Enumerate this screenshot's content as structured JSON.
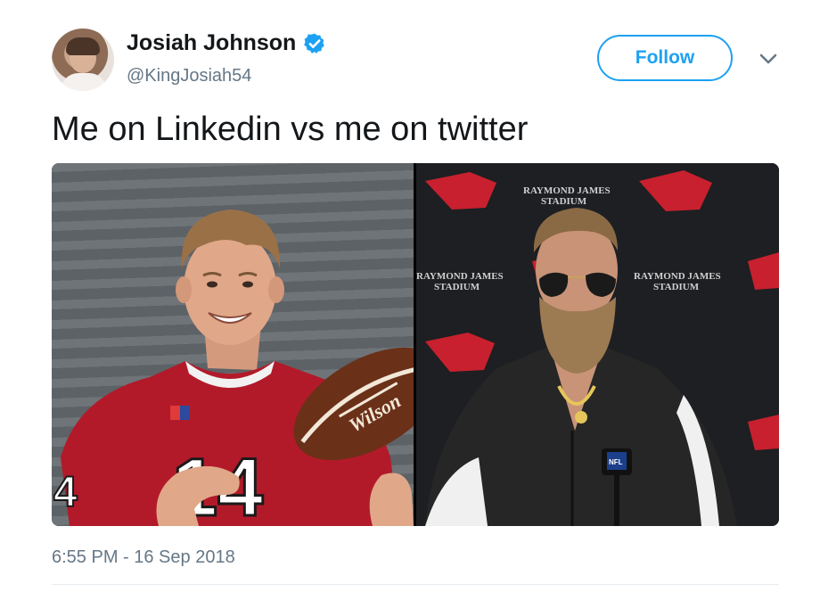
{
  "user": {
    "display_name": "Josiah Johnson",
    "handle": "@KingJosiah54",
    "verified": true
  },
  "actions": {
    "follow_label": "Follow"
  },
  "tweet": {
    "text": "Me on Linkedin vs me on twitter",
    "timestamp": "6:55 PM - 16 Sep 2018"
  },
  "media": {
    "left_photo": {
      "jersey_number": "14",
      "ball_brand": "Wilson"
    },
    "right_photo": {
      "backdrop_text": [
        "RAYMOND JAMES",
        "STADIUM"
      ],
      "mic_flag": "NFL"
    }
  },
  "colors": {
    "accent": "#1da1f2",
    "text": "#14171a",
    "secondary_text": "#657786",
    "jersey_red": "#b21a2a"
  }
}
